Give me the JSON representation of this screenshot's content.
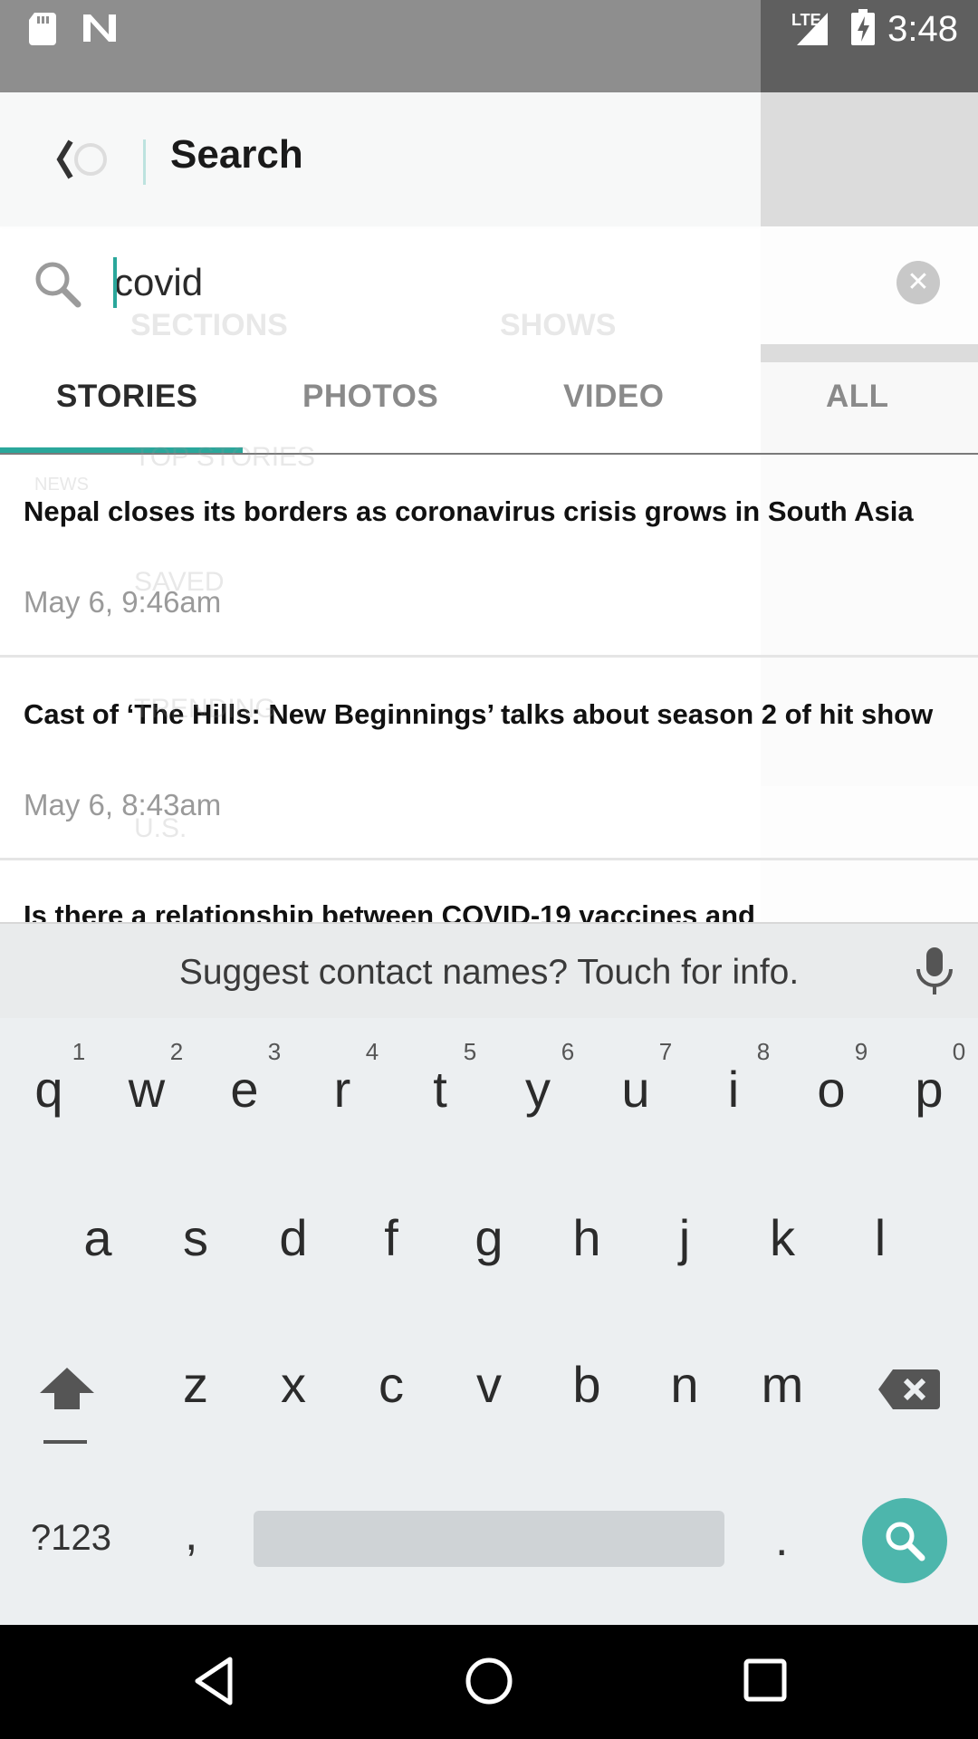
{
  "status_bar": {
    "time": "3:48",
    "network_label": "LTE",
    "icons": [
      "sd-card-icon",
      "n-app-icon",
      "signal-icon",
      "battery-charging-icon"
    ]
  },
  "header": {
    "title": "Search",
    "back_icon": "back-arrow-icon"
  },
  "search": {
    "value": "covid",
    "placeholder": ""
  },
  "background_menu": {
    "items": [
      "SECTIONS",
      "SHOWS",
      "TOP STORIES",
      "SAVED",
      "TRENDING",
      "U.S."
    ],
    "logo_text": "NEWS"
  },
  "tabs": [
    {
      "label": "STORIES",
      "active": true
    },
    {
      "label": "PHOTOS",
      "active": false
    },
    {
      "label": "VIDEO",
      "active": false
    },
    {
      "label": "ALL",
      "active": false
    }
  ],
  "stories": [
    {
      "title": "Nepal closes its borders as coronavirus crisis grows in South Asia",
      "date": "May 6, 9:46am"
    },
    {
      "title": "Cast of ‘The Hills: New Beginnings’ talks about season 2 of hit show",
      "date": "May 6, 8:43am"
    },
    {
      "title": "Is there a relationship between COVID-19 vaccines and",
      "date": ""
    }
  ],
  "keyboard": {
    "suggestion": "Suggest contact names? Touch for info.",
    "row1": [
      "q",
      "w",
      "e",
      "r",
      "t",
      "y",
      "u",
      "i",
      "o",
      "p"
    ],
    "row1_numbers": [
      "1",
      "2",
      "3",
      "4",
      "5",
      "6",
      "7",
      "8",
      "9",
      "0"
    ],
    "row2": [
      "a",
      "s",
      "d",
      "f",
      "g",
      "h",
      "j",
      "k",
      "l"
    ],
    "row3": [
      "z",
      "x",
      "c",
      "v",
      "b",
      "n",
      "m"
    ],
    "symbols_key": "?123",
    "comma_key": ",",
    "period_key": ".",
    "accent_color": "#4db6ac"
  },
  "colors": {
    "accent": "#2aa79b",
    "status_bar": "#8e8e8e"
  }
}
